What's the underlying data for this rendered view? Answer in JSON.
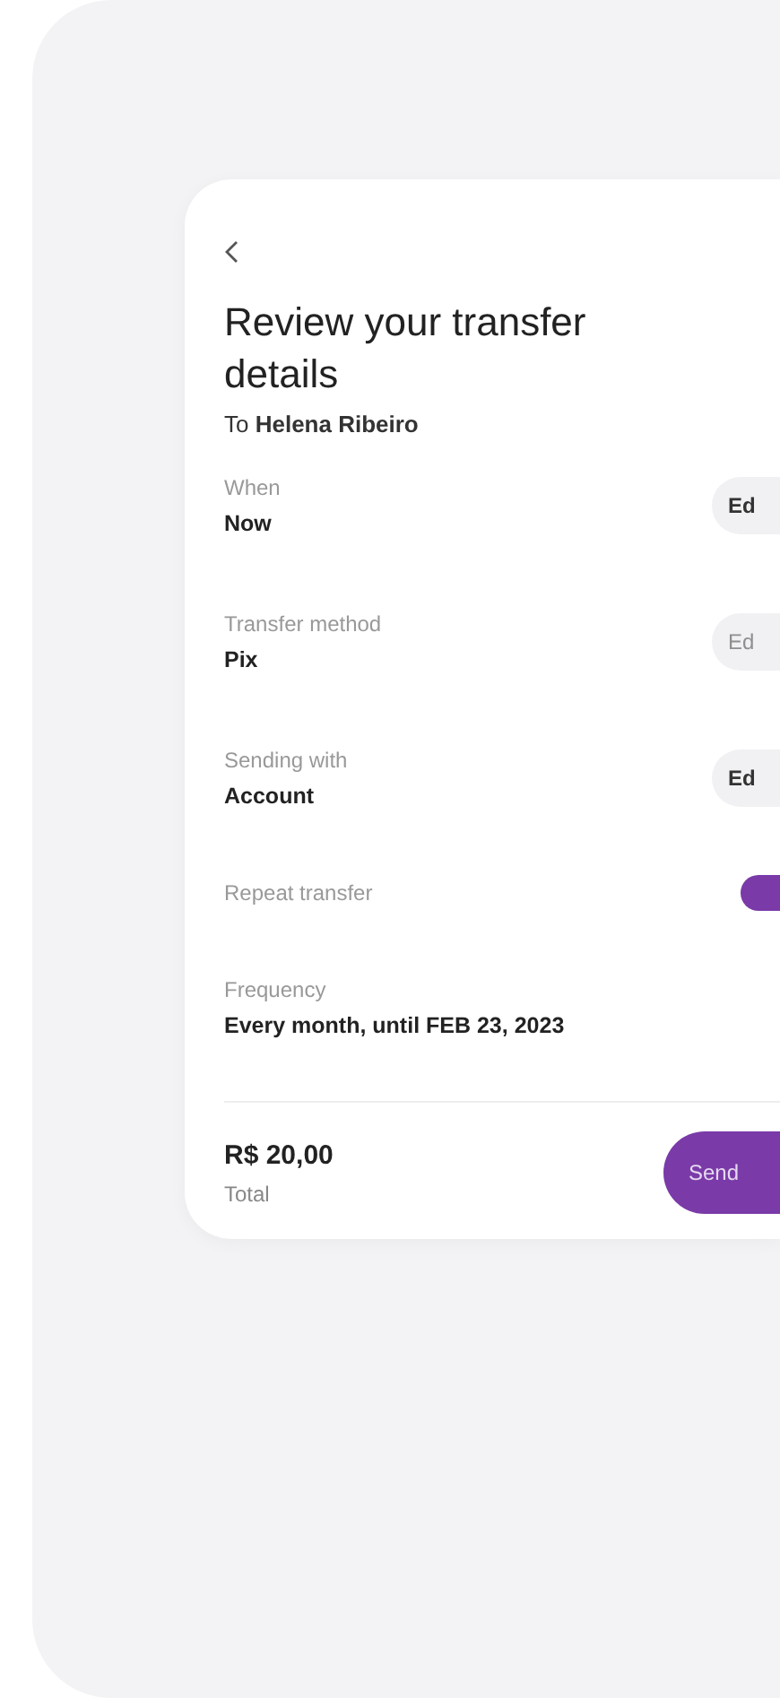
{
  "header": {
    "title": "Review your transfer details",
    "recipient": "To **Helena Ribeiro**"
  },
  "rows": [
    {
      "kind": "edit",
      "label": "When",
      "value": "Now",
      "action": "Ed",
      "disabled": false
    },
    {
      "kind": "edit",
      "label": "Transfer method",
      "value": "Pix",
      "action": "Ed",
      "disabled": true
    },
    {
      "kind": "edit",
      "label": "Sending with",
      "value": "Account",
      "action": "Ed",
      "disabled": false
    },
    {
      "kind": "toggle",
      "label": "Repeat transfer",
      "on": true
    },
    {
      "kind": "info",
      "label": "Frequency",
      "value": "Every month, until FEB 23, 2023"
    }
  ],
  "footer": {
    "amount": "R$ 20,00",
    "caption": "Total",
    "button": "Send"
  }
}
